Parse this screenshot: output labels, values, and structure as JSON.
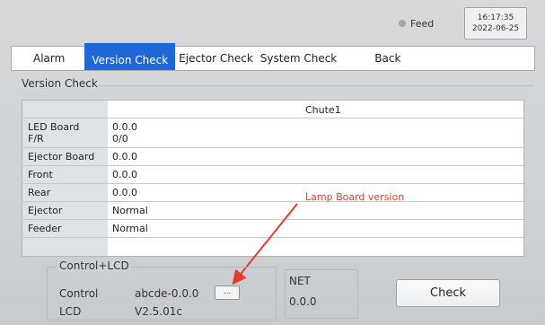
{
  "status": {
    "feed_label": "Feed",
    "time": "16:17:35",
    "date": "2022-06-25"
  },
  "tabs": [
    {
      "label": "Alarm",
      "active": false
    },
    {
      "label": "Version Check",
      "active": true
    },
    {
      "label": "Ejector Check",
      "active": false
    },
    {
      "label": "System Check",
      "active": false
    },
    {
      "label": "Back",
      "active": false
    }
  ],
  "panel": {
    "title": "Version Check",
    "column_header": "Chute1",
    "rows": [
      {
        "label_1": "LED Board",
        "value_1": "0.0.0",
        "label_2": "F/R",
        "value_2": "0/0"
      },
      {
        "label": "Ejector Board",
        "value": "0.0.0"
      },
      {
        "label": "Front",
        "value": "0.0.0"
      },
      {
        "label": "Rear",
        "value": "0.0.0"
      },
      {
        "label": "Ejector",
        "value": "Normal"
      },
      {
        "label": "Feeder",
        "value": "Normal"
      }
    ]
  },
  "annotation": {
    "text": "Lamp Board version",
    "color": "#e53b2e"
  },
  "control_lcd": {
    "title": "Control+LCD",
    "control_label": "Control",
    "control_value": "abcde-0.0.0",
    "more_button": "...",
    "lcd_label": "LCD",
    "lcd_value": "V2.5.01c"
  },
  "net": {
    "title": "NET",
    "value": "0.0.0"
  },
  "check_button": "Check",
  "colors": {
    "active_tab": "#1f67d8",
    "annotation": "#e53b2e"
  }
}
